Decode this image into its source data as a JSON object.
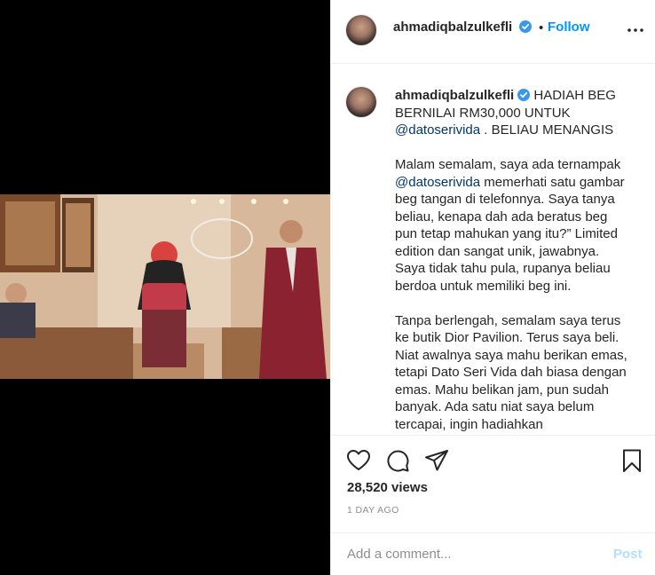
{
  "post": {
    "username": "ahmadiqbalzulkefli",
    "follow_label": "Follow",
    "dot": "•"
  },
  "caption": {
    "line1": "HADIAH BEG BERNILAI RM30,000 UNTUK",
    "mention1": "@datoserivida",
    "line1_end": ". BELIAU MENANGIS",
    "p2_a": "Malam semalam, saya ada ternampak",
    "p2_mention": "@datoserivida",
    "p2_b": "memerhati satu gambar beg tangan di telefonnya. Saya tanya beliau, kenapa dah ada beratus beg pun tetap mahukan yang itu?” Limited edition dan sangat unik, jawabnya. Saya tidak tahu pula, rupanya beliau berdoa untuk memiliki beg ini.",
    "p3": "Tanpa berlengah, semalam saya terus ke butik Dior Pavilion. Terus saya beli. Niat awalnya saya mahu berikan emas, tetapi Dato Seri Vida dah biasa dengan emas. Mahu belikan jam, pun sudah banyak. Ada satu niat saya belum tercapai, ingin hadiahkan"
  },
  "stats": {
    "views": "28,520 views",
    "date": "1 DAY AGO"
  },
  "comment": {
    "placeholder": "Add a comment...",
    "post_label": "Post"
  },
  "icons": {
    "verified": "verified-badge-icon",
    "more": "more-options-icon",
    "like": "heart-icon",
    "comment": "comment-bubble-icon",
    "share": "paper-plane-icon",
    "save": "bookmark-icon"
  },
  "colors": {
    "accent": "#0095f6",
    "mention": "#00376b",
    "muted": "#8e8e8e",
    "post_disabled": "#b2dffc"
  }
}
